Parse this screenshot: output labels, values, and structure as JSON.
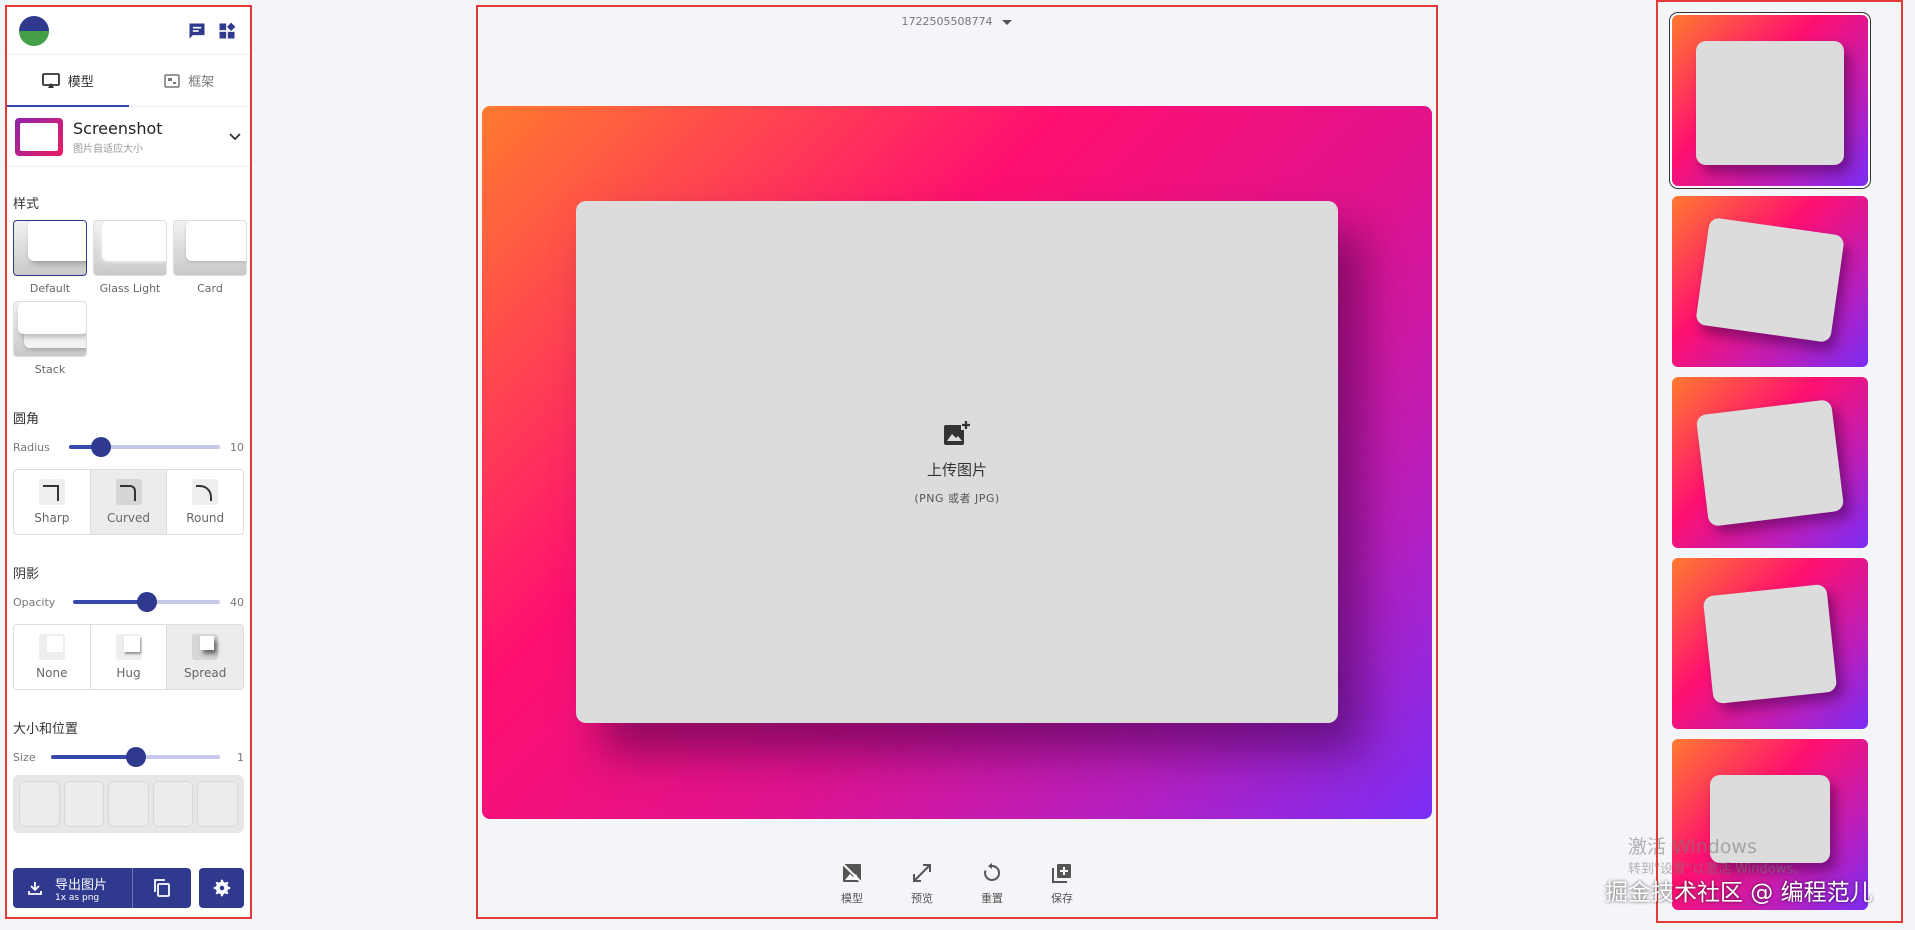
{
  "app": {
    "top_icons": [
      "chat-icon",
      "widgets-icon"
    ]
  },
  "tabs": [
    {
      "label": "模型",
      "icon": "monitor-icon",
      "active": true
    },
    {
      "label": "框架",
      "icon": "frame-icon",
      "active": false
    }
  ],
  "model_select": {
    "title": "Screenshot",
    "subtitle": "图片自适应大小"
  },
  "style_section": {
    "title": "样式",
    "options": [
      "Default",
      "Glass Light",
      "Card",
      "Stack"
    ],
    "selected": "Default"
  },
  "corner_section": {
    "title": "圆角",
    "slider_label": "Radius",
    "slider_value": "10",
    "slider_fraction": 0.21,
    "options": [
      "Sharp",
      "Curved",
      "Round"
    ],
    "selected": "Curved"
  },
  "shadow_section": {
    "title": "阴影",
    "slider_label": "Opacity",
    "slider_value": "40",
    "slider_fraction": 0.5,
    "options": [
      "None",
      "Hug",
      "Spread"
    ],
    "selected": "Spread"
  },
  "size_section": {
    "title": "大小和位置",
    "slider_label": "Size",
    "slider_value": "1",
    "slider_fraction": 0.5
  },
  "export": {
    "label": "导出图片",
    "sublabel": "1x as png"
  },
  "canvas": {
    "file_name": "1722505508774",
    "upload_title": "上传图片",
    "upload_hint": "(PNG 或者 JPG)",
    "gradient_colors": [
      "#ff7a2f",
      "#ff1070",
      "#b81fbe",
      "#7a2df5"
    ]
  },
  "toolbar": [
    {
      "label": "模型",
      "icon": "hide-image-icon"
    },
    {
      "label": "预览",
      "icon": "expand-icon"
    },
    {
      "label": "重置",
      "icon": "reset-icon"
    },
    {
      "label": "保存",
      "icon": "add-library-icon"
    }
  ],
  "watermark": {
    "line1": "激活 Windows",
    "line2": "转到\"设置\"以激活 Windows。",
    "credit": "掘金技术社区 @ 编程范儿"
  },
  "colors": {
    "accent": "#2f3a8f",
    "annotation": "#e53935"
  }
}
